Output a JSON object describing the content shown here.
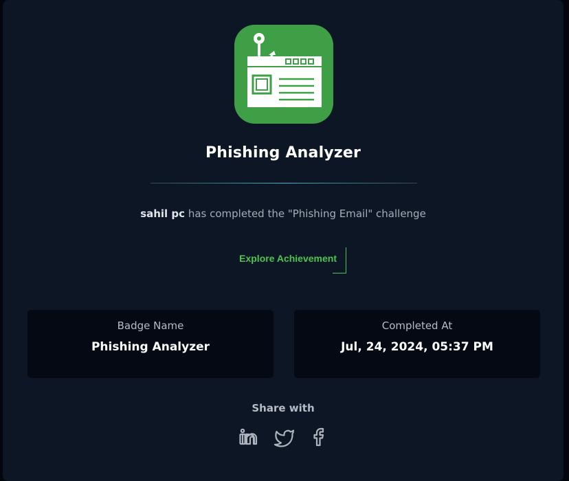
{
  "badge": {
    "title": "Phishing Analyzer",
    "icon": "phishing-email-hook-icon",
    "icon_color": "#3e9f47"
  },
  "completion": {
    "user": "sahil pc",
    "text": " has completed the \"Phishing Email\" challenge"
  },
  "explore_button": {
    "label": "Explore Achievement",
    "color": "#4cc553"
  },
  "details": {
    "badge_name_label": "Badge Name",
    "badge_name_value": "Phishing Analyzer",
    "completed_at_label": "Completed At",
    "completed_at_value": "Jul, 24, 2024, 05:37 PM"
  },
  "share": {
    "label": "Share with",
    "networks": [
      "linkedin-icon",
      "twitter-icon",
      "facebook-icon"
    ]
  }
}
